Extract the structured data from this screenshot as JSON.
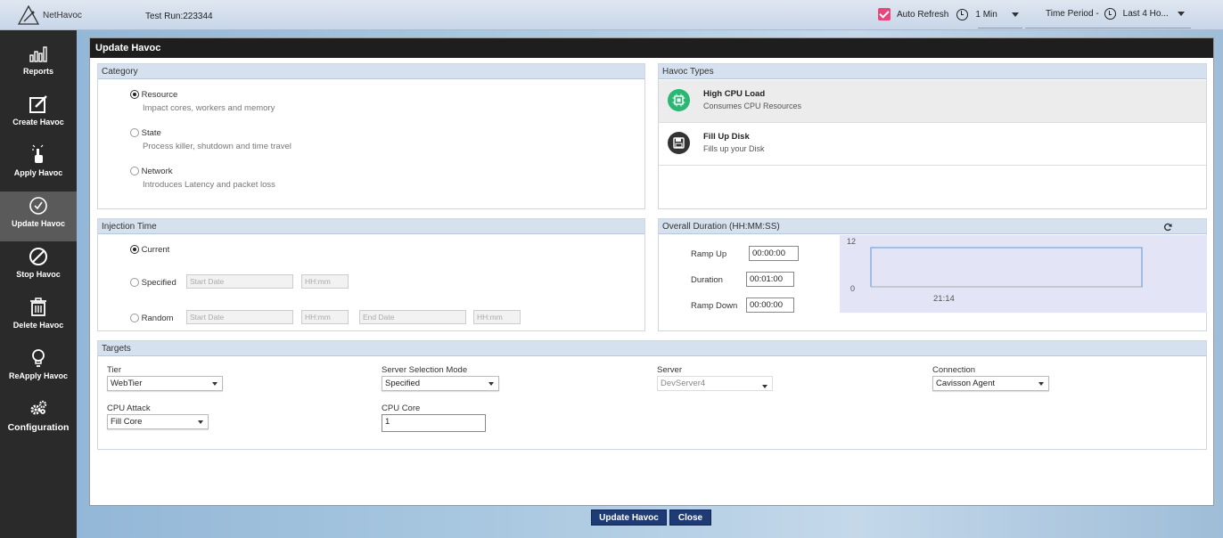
{
  "header": {
    "logo_text": "NetHavoc",
    "test_run": "Test Run:223344",
    "auto_refresh_label": "Auto Refresh",
    "refresh_interval": "1 Min",
    "time_period_label": "Time Period -",
    "time_period_value": "Last 4 Ho..."
  },
  "sidebar": {
    "items": [
      {
        "label": "Reports",
        "icon": "bar-chart-icon"
      },
      {
        "label": "Create Havoc",
        "icon": "edit-icon"
      },
      {
        "label": "Apply Havoc",
        "icon": "hand-pointer-icon"
      },
      {
        "label": "Update Havoc",
        "icon": "check-circle-icon"
      },
      {
        "label": "Stop Havoc",
        "icon": "stop-icon"
      },
      {
        "label": "Delete Havoc",
        "icon": "trash-icon"
      },
      {
        "label": "ReApply Havoc",
        "icon": "bulb-icon"
      },
      {
        "label": "Configuration",
        "icon": "gears-icon"
      }
    ]
  },
  "dialog": {
    "title": "Update Havoc",
    "category": {
      "title": "Category",
      "options": [
        {
          "label": "Resource",
          "desc": "Impact cores, workers and memory",
          "selected": true
        },
        {
          "label": "State",
          "desc": "Process killer, shutdown and time travel",
          "selected": false
        },
        {
          "label": "Network",
          "desc": "Introduces Latency and packet loss",
          "selected": false
        }
      ]
    },
    "havoc_types": {
      "title": "Havoc Types",
      "items": [
        {
          "title": "High CPU Load",
          "desc": "Consumes CPU Resources",
          "icon": "cpu-icon",
          "color": "#2bb673"
        },
        {
          "title": "Fill Up Disk",
          "desc": "Fills up your Disk",
          "icon": "floppy-disk-icon",
          "color": "#333333"
        }
      ]
    },
    "injection_time": {
      "title": "Injection Time",
      "current_label": "Current",
      "specified_label": "Specified",
      "random_label": "Random",
      "start_date_placeholder": "Start Date",
      "time_placeholder": "HH:mm",
      "end_date_placeholder": "End Date"
    },
    "duration": {
      "title": "Overall Duration (HH:MM:SS)",
      "ramp_up_label": "Ramp Up",
      "ramp_up": "00:00:00",
      "duration_label": "Duration",
      "duration": "00:01:00",
      "ramp_down_label": "Ramp Down",
      "ramp_down": "00:00:00",
      "chart": {
        "y_max": "12",
        "y_min": "0",
        "x_label": "21:14"
      }
    },
    "targets": {
      "title": "Targets",
      "tier_label": "Tier",
      "tier": "WebTier",
      "server_mode_label": "Server Selection Mode",
      "server_mode": "Specified",
      "server_label": "Server",
      "server": "DevServer4",
      "connection_label": "Connection",
      "connection": "Cavisson Agent",
      "cpu_attack_label": "CPU Attack",
      "cpu_attack": "Fill Core",
      "cpu_core_label": "CPU Core",
      "cpu_core": "1"
    }
  },
  "buttons": {
    "update": "Update Havoc",
    "close": "Close"
  }
}
